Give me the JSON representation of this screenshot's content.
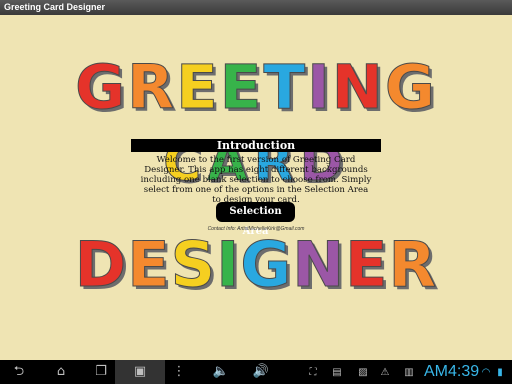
{
  "window": {
    "title": "Greeting Card Designer"
  },
  "heading": {
    "greeting": [
      {
        "ch": "G",
        "color": "#e5332a"
      },
      {
        "ch": "R",
        "color": "#f4892e"
      },
      {
        "ch": "E",
        "color": "#f5cf20"
      },
      {
        "ch": "E",
        "color": "#37b34a"
      },
      {
        "ch": "T",
        "color": "#29a8e0"
      },
      {
        "ch": "I",
        "color": "#9b57a6"
      },
      {
        "ch": "N",
        "color": "#e5332a"
      },
      {
        "ch": "G",
        "color": "#f4892e"
      }
    ],
    "card": [
      {
        "ch": "C",
        "color": "#f5cf20"
      },
      {
        "ch": "A",
        "color": "#37b34a"
      },
      {
        "ch": "R",
        "color": "#29a8e0"
      },
      {
        "ch": "D",
        "color": "#9b57a6"
      }
    ],
    "designer": [
      {
        "ch": "D",
        "color": "#e5332a"
      },
      {
        "ch": "E",
        "color": "#f4892e"
      },
      {
        "ch": "S",
        "color": "#f5cf20"
      },
      {
        "ch": "I",
        "color": "#37b34a"
      },
      {
        "ch": "G",
        "color": "#29a8e0"
      },
      {
        "ch": "N",
        "color": "#9b57a6"
      },
      {
        "ch": "E",
        "color": "#e5332a"
      },
      {
        "ch": "R",
        "color": "#f4892e"
      }
    ]
  },
  "intro": {
    "title": "Introduction",
    "text": "Welcome to the first version of Greeting Card Designer. This app has eight different backgrounds including one blank selection to choose from. Simply select from one of the options in the Selection Area to design your card."
  },
  "selection_button": "Selection Area",
  "contact": "Contact Info: ArtistMichelleKirk@Gmail.com",
  "navbar": {
    "back_icon": "back-icon",
    "home_icon": "home-icon",
    "recents_icon": "recents-icon",
    "screenshot_icon": "screenshot-icon",
    "menu_icon": "menu-icon",
    "volume_down_icon": "volume-down-icon",
    "volume_up_icon": "volume-up-icon",
    "clock": "AM4:39"
  },
  "colors": {
    "background": "#efe4b3",
    "clock": "#38b6e8"
  }
}
